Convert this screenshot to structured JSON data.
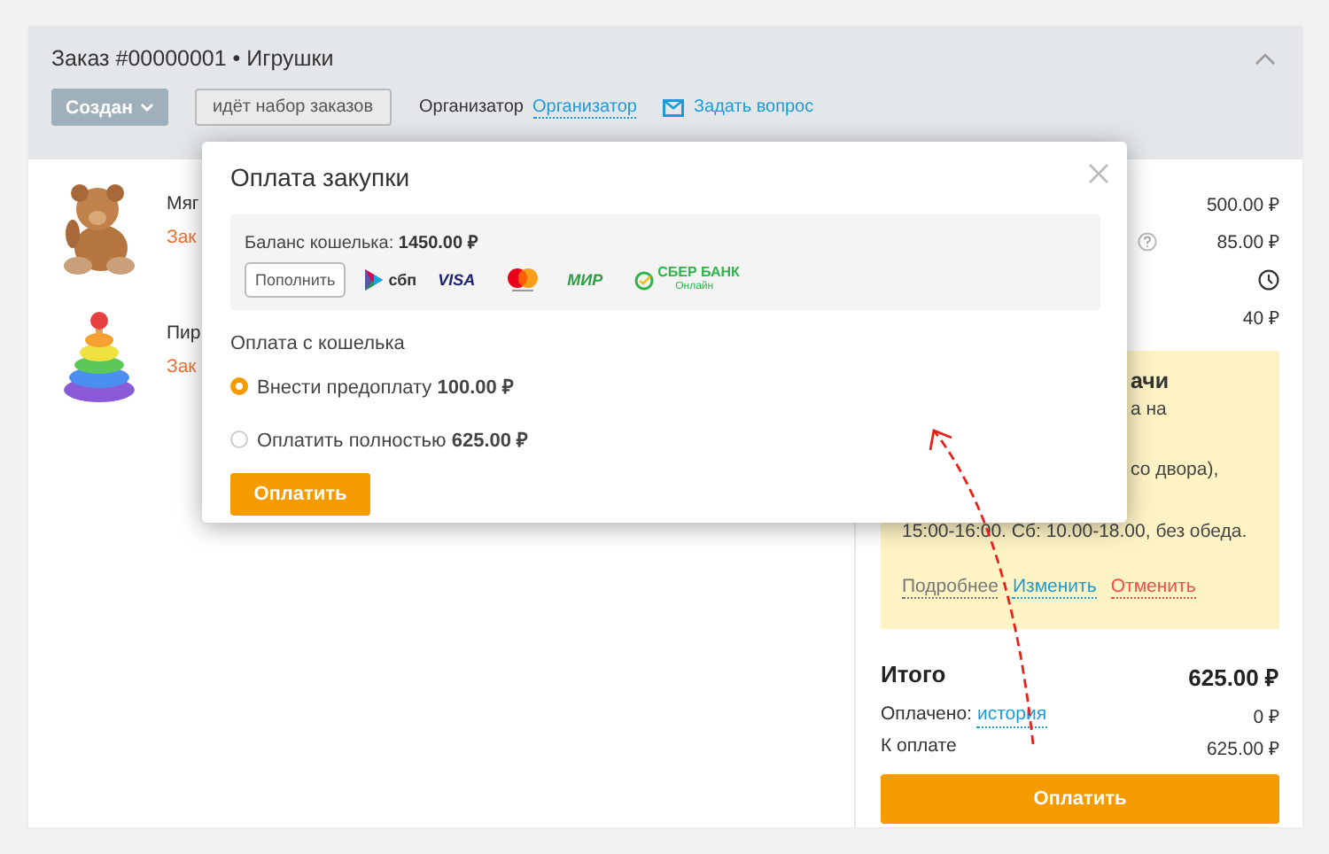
{
  "order": {
    "title": "Заказ #00000001 • Игрушки",
    "status_button": "Создан",
    "stage_badge": "идёт набор заказов",
    "organizer_label": "Организатор",
    "organizer_link": "Организатор",
    "ask_link": "Задать вопрос"
  },
  "items": [
    {
      "kind": "bear",
      "name": "Мяг",
      "order_link": "Зак"
    },
    {
      "kind": "pyramid",
      "name": "Пир",
      "order_link": "Зак"
    }
  ],
  "summary_rows": [
    {
      "kind": "price",
      "value": "500.00 ₽"
    },
    {
      "kind": "help",
      "value": "85.00 ₽"
    },
    {
      "kind": "clock"
    },
    {
      "kind": "price",
      "value": "40 ₽"
    }
  ],
  "pickup": {
    "lines": [
      {
        "kind": "title",
        "text": "ачи"
      },
      {
        "kind": "partial",
        "text": "а на"
      },
      {
        "kind": "covered"
      },
      {
        "kind": "partial",
        "text": "со двора),"
      },
      {
        "kind": "covered"
      },
      {
        "kind": "full",
        "text": "15:00-16:00. Сб: 10.00-18.00, без обеда."
      }
    ],
    "links": [
      {
        "label": "Подробнее",
        "color": "#777777"
      },
      {
        "label": "Изменить",
        "color": "#1e9bd7"
      },
      {
        "label": "Отменить",
        "color": "#f0504a"
      }
    ]
  },
  "totals": {
    "total_label": "Итого",
    "total_value": "625.00 ₽",
    "paid_label": "Оплачено:",
    "paid_link": "история",
    "paid_value": "0 ₽",
    "due_label": "К оплате",
    "due_value": "625.00 ₽",
    "pay_button": "Оплатить"
  },
  "modal": {
    "title": "Оплата закупки",
    "balance": "Баланс кошелька: **1450.00 ₽**",
    "top_up_button": "Пополнить",
    "payment_methods": [
      {
        "kind": "sbp",
        "label": "сбп"
      },
      {
        "kind": "visa",
        "label": "VISA"
      },
      {
        "kind": "mastercard"
      },
      {
        "kind": "mir",
        "label": "МИР"
      },
      {
        "kind": "sber",
        "label": "СБЕР БАНК",
        "sublabel": "Онлайн"
      }
    ],
    "section_title": "Оплата с кошелька",
    "options": [
      {
        "label": "Внести предоплату **100.00 ₽**",
        "selected": true
      },
      {
        "label": "Оплатить полностью **625.00 ₽**",
        "selected": false
      }
    ],
    "pay_button": "Оплатить"
  }
}
